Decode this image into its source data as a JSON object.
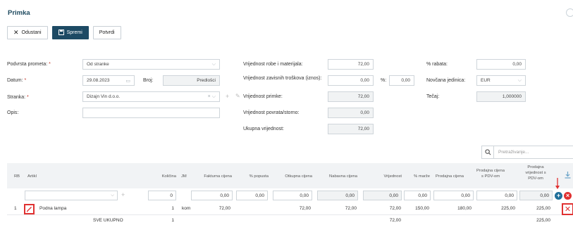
{
  "page": {
    "title": "Primka"
  },
  "toolbar": {
    "cancel": "Odustani",
    "save": "Spremi",
    "confirm": "Potvrdi"
  },
  "form": {
    "left": {
      "transaction_label": "Podvrsta prometa:",
      "transaction_value": "Od stranke",
      "date_label": "Datum:",
      "date_value": "29.08.2023",
      "number_label": "Broj:",
      "number_value": "Predlošci",
      "party_label": "Stranka:",
      "party_value": "Dizajn Vin d.o.o.",
      "desc_label": "Opis:",
      "desc_value": ""
    },
    "middle": {
      "goods_label": "Vrijednost robe i materijala:",
      "goods_value": "72,00",
      "dep_costs_label": "Vrijednost zavisnih troškova (iznos):",
      "dep_costs_value": "0,00",
      "pct_label": "%:",
      "pct_value": "0,00",
      "receipt_label": "Vrijednost primke:",
      "receipt_value": "72,00",
      "return_label": "Vrijednost povrata/storno:",
      "return_value": "0,00",
      "total_label": "Ukupna vrijednost:",
      "total_value": "72,00"
    },
    "right": {
      "discount_label": "% rabata:",
      "discount_value": "0,00",
      "currency_label": "Novčana jedinica:",
      "currency_value": "EUR",
      "rate_label": "Tečaj:",
      "rate_value": "1,000000"
    }
  },
  "search": {
    "placeholder": "Pretraživanje..."
  },
  "table": {
    "headers": {
      "rb": "RB",
      "article": "Artikl",
      "qty": "Količina",
      "unit": "JM",
      "invoice_price": "Fakturna cijena",
      "discount_pct": "% popusta",
      "purchase_price": "Otkupna cijena",
      "cost_price": "Nabavna cijena",
      "value": "Vrijednost",
      "margin_pct": "% marže",
      "sale_price": "Prodajna cijena",
      "sale_price_vat_1": "Prodajna cijena",
      "sale_price_vat_2": "s PDV-om",
      "sale_value_vat_1": "Prodajna",
      "sale_value_vat_2": "vrijednost s",
      "sale_value_vat_3": "PDV-om"
    },
    "input_row": {
      "qty": "0",
      "invoice_price": "0,00",
      "discount_pct": "0,00",
      "purchase_price": "0,00",
      "cost_price": "0,00",
      "value": "0,00",
      "margin_pct": "0,00",
      "sale_price": "0,00",
      "sale_price_vat": "0,00",
      "sale_value_vat": "0,00"
    },
    "rows": [
      {
        "rb": "1",
        "article": "Podna lampa",
        "qty": "1",
        "unit": "kom",
        "invoice_price": "72,00",
        "purchase_price": "72,00",
        "cost_price": "72,00",
        "value": "72,00",
        "margin_pct": "150,00",
        "sale_price": "180,00",
        "sale_price_vat": "225,00",
        "sale_value_vat": "225,00"
      }
    ],
    "summary": {
      "label": "SVE UKUPNO",
      "qty": "1",
      "value": "72,00",
      "sale_value_vat": "225,00"
    }
  },
  "colors": {
    "primary": "#1d4a64",
    "accent_red": "#e03131",
    "add_blue": "#1f6f9a"
  }
}
